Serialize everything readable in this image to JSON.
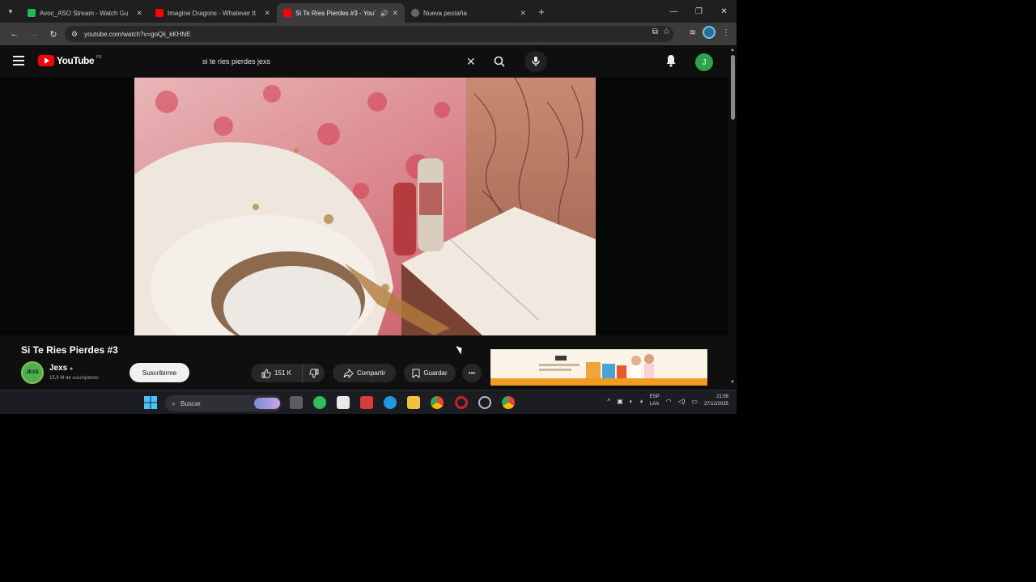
{
  "browser": {
    "tabs": [
      {
        "title": "Avoc_ASO Stream - Watch Gu",
        "favicon_color": "#1db954"
      },
      {
        "title": "Imagine Dragons - Whatever It",
        "favicon_color": "#ff0000"
      },
      {
        "title": "Si Te Ríes Pierdes #3 - YouT",
        "favicon_color": "#ff0000"
      },
      {
        "title": "Nueva pestaña",
        "favicon_color": "#bbbbbb"
      }
    ],
    "url": "youtube.com/watch?v=goQii_kKHNE"
  },
  "youtube": {
    "search_query": "si te ries pierdes jexs",
    "logo_text": "YouTube",
    "logo_region": "PE",
    "avatar_letter": "J"
  },
  "video": {
    "title": "Si Te Ries Pierdes #3",
    "channel_name": "Jexs",
    "channel_subs": "15,9 M de suscriptores",
    "channel_avatar_text": "JEXS",
    "subscribe_label": "Suscribirme",
    "likes": "151 K",
    "share_label": "Compartir",
    "save_label": "Guardar"
  },
  "taskbar": {
    "search_label": "Buscar",
    "lang_top": "ESP",
    "lang_bottom": "LAA",
    "time": "21:58",
    "date": "27/12/2025"
  }
}
